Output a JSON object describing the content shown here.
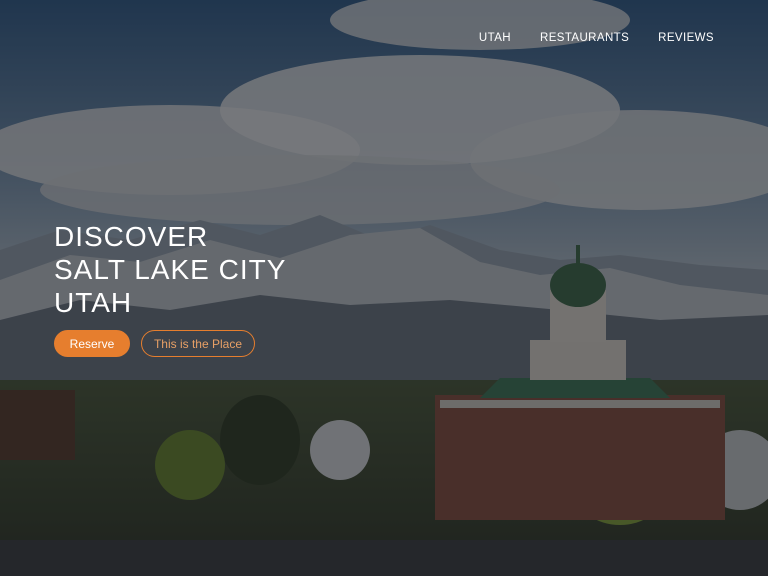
{
  "nav": {
    "items": [
      {
        "label": "UTAH"
      },
      {
        "label": "RESTAURANTS"
      },
      {
        "label": "REVIEWS"
      }
    ]
  },
  "hero": {
    "headline_lines": [
      "DISCOVER",
      "SALT LAKE CITY",
      "UTAH"
    ],
    "primary_button": "Reserve",
    "secondary_button": "This is the Place"
  },
  "colors": {
    "accent": "#e67e2e",
    "overlay": "#14161a",
    "text": "#ffffff"
  }
}
